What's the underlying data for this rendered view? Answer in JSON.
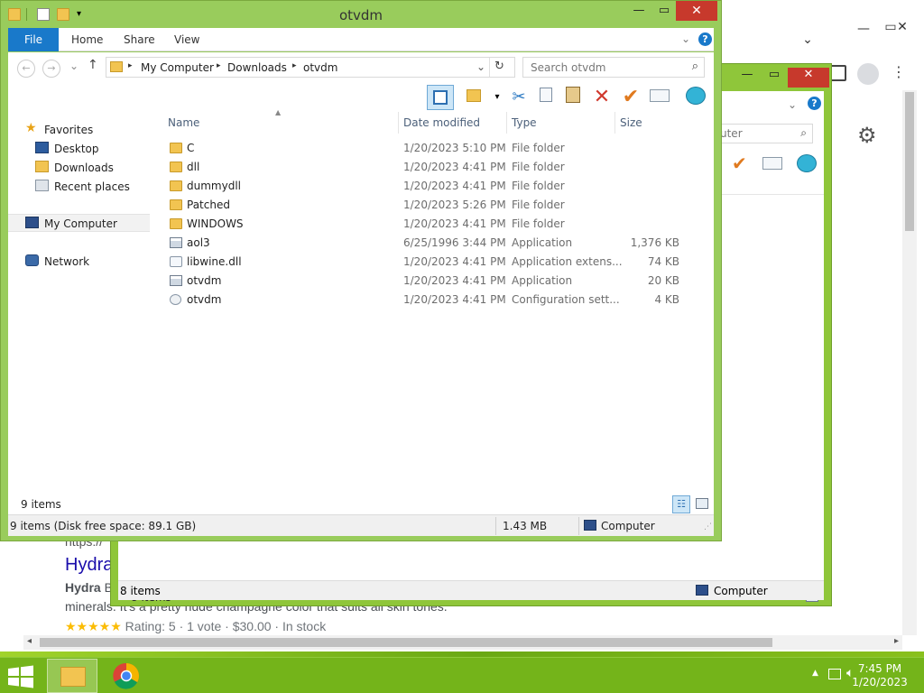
{
  "explorer": {
    "title": "otvdm",
    "ribbon_tabs": [
      "File",
      "Home",
      "Share",
      "View"
    ],
    "address": {
      "segments": [
        "My Computer",
        "Downloads",
        "otvdm"
      ]
    },
    "search_placeholder": "Search otvdm",
    "nav_pane": {
      "favorites_label": "Favorites",
      "favorites": [
        "Desktop",
        "Downloads",
        "Recent places"
      ],
      "computer_label": "My Computer",
      "network_label": "Network"
    },
    "columns": {
      "name": "Name",
      "date": "Date modified",
      "type": "Type",
      "size": "Size"
    },
    "files": [
      {
        "name": "C",
        "date": "1/20/2023 5:10 PM",
        "type": "File folder",
        "size": "",
        "icon": "folder-icon"
      },
      {
        "name": "dll",
        "date": "1/20/2023 4:41 PM",
        "type": "File folder",
        "size": "",
        "icon": "folder-icon"
      },
      {
        "name": "dummydll",
        "date": "1/20/2023 4:41 PM",
        "type": "File folder",
        "size": "",
        "icon": "folder-icon"
      },
      {
        "name": "Patched",
        "date": "1/20/2023 5:26 PM",
        "type": "File folder",
        "size": "",
        "icon": "folder-icon"
      },
      {
        "name": "WINDOWS",
        "date": "1/20/2023 4:41 PM",
        "type": "File folder",
        "size": "",
        "icon": "folder-icon"
      },
      {
        "name": "aol3",
        "date": "6/25/1996 3:44 PM",
        "type": "Application",
        "size": "1,376 KB",
        "icon": "application-icon"
      },
      {
        "name": "libwine.dll",
        "date": "1/20/2023 4:41 PM",
        "type": "Application extens...",
        "size": "74 KB",
        "icon": "dll-icon"
      },
      {
        "name": "otvdm",
        "date": "1/20/2023 4:41 PM",
        "type": "Application",
        "size": "20 KB",
        "icon": "application-icon"
      },
      {
        "name": "otvdm",
        "date": "1/20/2023 4:41 PM",
        "type": "Configuration sett...",
        "size": "4 KB",
        "icon": "config-file-icon"
      }
    ],
    "item_count": "9 items",
    "status": {
      "disk": "9 items (Disk free space: 89.1 GB)",
      "size": "1.43 MB",
      "location": "Computer"
    }
  },
  "explorer_back": {
    "search_fragment": "uter",
    "item_count": "8 items",
    "status_items": "8 items",
    "status_location": "Computer"
  },
  "browser": {
    "url_fragment": "https://",
    "result_title": "Hydra",
    "result_line1_bold": "Hydra",
    "result_line1_rest": " B",
    "result_line2": "minerals. It's a pretty nude champagne color that suits all skin tones.",
    "stars": "★★★★★",
    "rating": " Rating: 5 · 1 vote · $30.00 · In stock"
  },
  "taskbar": {
    "time": "7:45 PM",
    "date": "1/20/2023"
  },
  "colors": {
    "desktop": "#7cc01c",
    "window_frame": "#99cc5c",
    "file_tab": "#1979ca",
    "close_button": "#c7392c"
  }
}
